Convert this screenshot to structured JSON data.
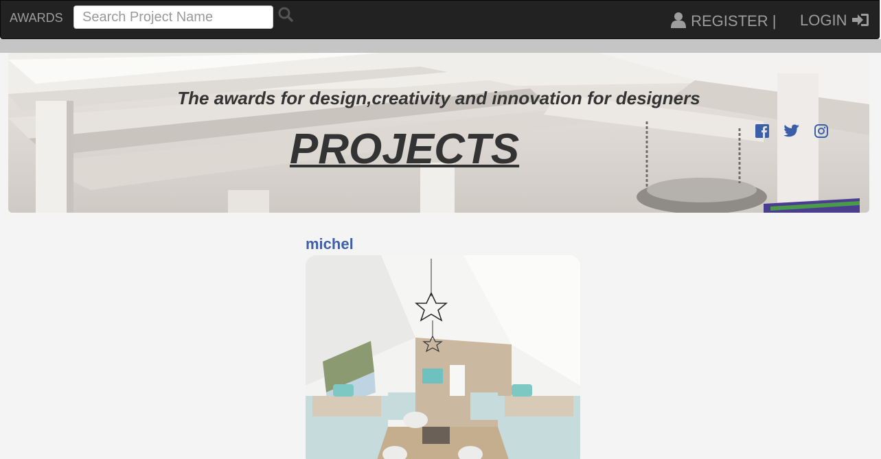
{
  "navbar": {
    "brand": "AWARDS",
    "search_placeholder": "Search Project Name",
    "register_label": "REGISTER |",
    "login_label": "LOGIN"
  },
  "hero": {
    "tagline": "The awards for design,creativity and innovation for designers",
    "title": "PROJECTS",
    "social_icons": [
      "facebook-icon",
      "twitter-icon",
      "instagram-icon"
    ]
  },
  "projects": [
    {
      "title": "michel"
    }
  ],
  "colors": {
    "navbar_bg": "#222222",
    "nav_text": "#9d9d9d",
    "link": "#3f5ea8",
    "social": "#3b5ea8",
    "page_bg": "#f4f4f4"
  }
}
